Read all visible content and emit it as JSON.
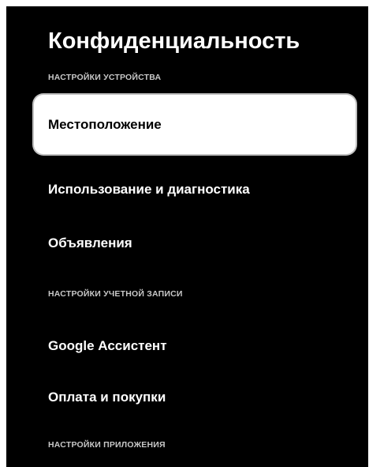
{
  "header": {
    "title": "Конфиденциальность"
  },
  "sections": {
    "device": "НАСТРОЙКИ УСТРОЙСТВА",
    "account": "НАСТРОЙКИ УЧЕТНОЙ ЗАПИСИ",
    "app": "НАСТРОЙКИ ПРИЛОЖЕНИЯ"
  },
  "items": {
    "location": "Местоположение",
    "usage": "Использование и диагностика",
    "ads": "Объявления",
    "assistant": "Google Ассистент",
    "payments": "Оплата и покупки"
  },
  "colors": {
    "background": "#000000",
    "text": "#ffffff",
    "focused_background": "#ffffff",
    "focused_text": "#000000",
    "section_text": "#c8c8c8"
  }
}
